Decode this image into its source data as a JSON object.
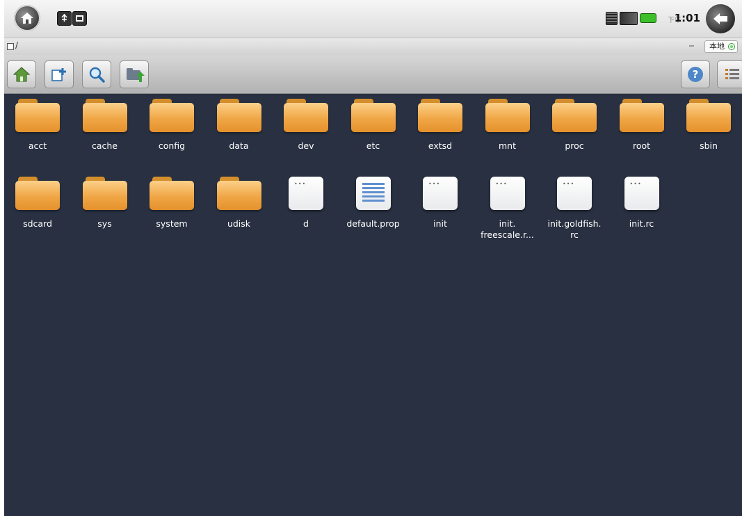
{
  "status_bar": {
    "time_ampm": "下午",
    "time": "1:01",
    "icons": [
      "home-orb-icon",
      "usb-notification-icon",
      "screenshot-notification-icon",
      "sd-card-icon",
      "signal-icon",
      "battery-icon",
      "back-orb-icon"
    ]
  },
  "path_bar": {
    "path": "/",
    "location_label": "本地"
  },
  "toolbar": {
    "left_buttons": [
      "home-icon",
      "new-folder-icon",
      "search-icon",
      "folder-up-icon"
    ],
    "right_buttons": [
      "help-icon",
      "menu-list-icon"
    ]
  },
  "files": [
    {
      "name": "acct",
      "type": "folder"
    },
    {
      "name": "cache",
      "type": "folder"
    },
    {
      "name": "config",
      "type": "folder"
    },
    {
      "name": "data",
      "type": "folder"
    },
    {
      "name": "dev",
      "type": "folder"
    },
    {
      "name": "etc",
      "type": "folder"
    },
    {
      "name": "extsd",
      "type": "folder"
    },
    {
      "name": "mnt",
      "type": "folder"
    },
    {
      "name": "proc",
      "type": "folder"
    },
    {
      "name": "root",
      "type": "folder"
    },
    {
      "name": "sbin",
      "type": "folder"
    },
    {
      "name": "sdcard",
      "type": "folder"
    },
    {
      "name": "sys",
      "type": "folder"
    },
    {
      "name": "system",
      "type": "folder"
    },
    {
      "name": "udisk",
      "type": "folder"
    },
    {
      "name": "d",
      "type": "file"
    },
    {
      "name": "default.prop",
      "type": "text"
    },
    {
      "name": "init",
      "type": "file"
    },
    {
      "name": "init.\nfreescale.r...",
      "type": "file"
    },
    {
      "name": "init.goldfish.\nrc",
      "type": "file"
    },
    {
      "name": "init.rc",
      "type": "file"
    }
  ]
}
